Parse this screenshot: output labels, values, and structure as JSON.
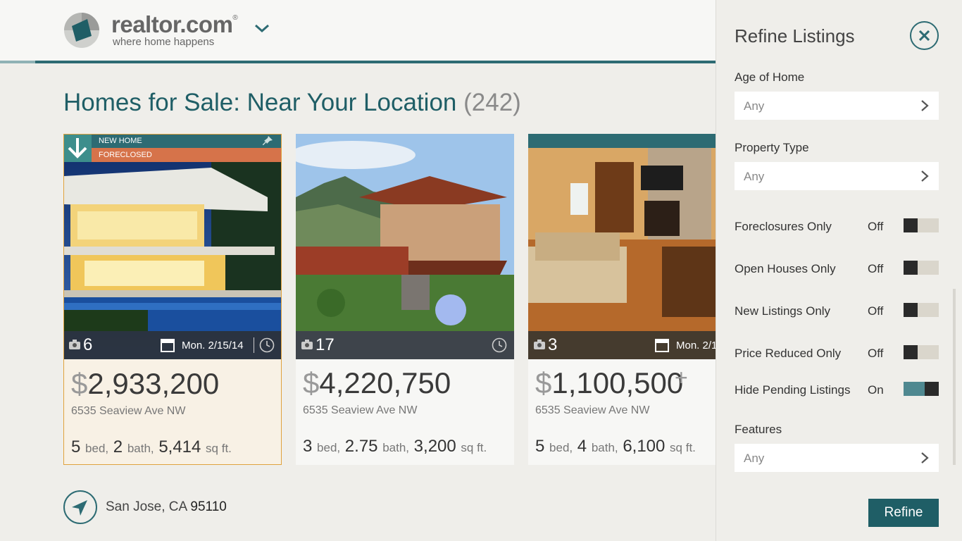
{
  "header": {
    "brand": "realtor.com",
    "registered": "®",
    "tagline": "where home happens"
  },
  "title": {
    "text": "Homes for Sale: Near Your Location",
    "count": "(242)"
  },
  "listings": [
    {
      "badge_new": "NEW HOME",
      "badge_foreclosed": "FORECLOSED",
      "photos": "6",
      "open_house": "Mon. 2/15/14",
      "currency": "$",
      "price": "2,933,200",
      "address": "6535 Seaview Ave NW",
      "beds": "5",
      "beds_unit": "bed,",
      "baths": "2",
      "baths_unit": "bath,",
      "sqft": "5,414",
      "sqft_unit": "sq ft."
    },
    {
      "photos": "17",
      "currency": "$",
      "price": "4,220,750",
      "address": "6535 Seaview Ave NW",
      "beds": "3",
      "beds_unit": "bed,",
      "baths": "2.75",
      "baths_unit": "bath,",
      "sqft": "3,200",
      "sqft_unit": "sq ft."
    },
    {
      "photos": "3",
      "open_house": "Mon. 2/1",
      "currency": "$",
      "price": "1,100,500",
      "price_suffix": "+",
      "address": "6535 Seaview Ave NW",
      "beds": "5",
      "beds_unit": "bed,",
      "baths": "4",
      "baths_unit": "bath,",
      "sqft": "6,100",
      "sqft_unit": "sq ft."
    }
  ],
  "location": {
    "city": "San Jose, CA",
    "zip": "95110"
  },
  "panel": {
    "title": "Refine Listings",
    "age_label": "Age of Home",
    "age_value": "Any",
    "type_label": "Property Type",
    "type_value": "Any",
    "toggles": [
      {
        "label": "Foreclosures Only",
        "state": "Off"
      },
      {
        "label": "Open Houses Only",
        "state": "Off"
      },
      {
        "label": "New Listings Only",
        "state": "Off"
      },
      {
        "label": "Price Reduced Only",
        "state": "Off"
      },
      {
        "label": "Hide Pending Listings",
        "state": "On"
      }
    ],
    "features_label": "Features",
    "features_value": "Any",
    "refine_label": "Refine"
  },
  "colors": {
    "accent": "#2d6b73",
    "foreclosed": "#d6734a",
    "selected_border": "#e0a23d"
  }
}
